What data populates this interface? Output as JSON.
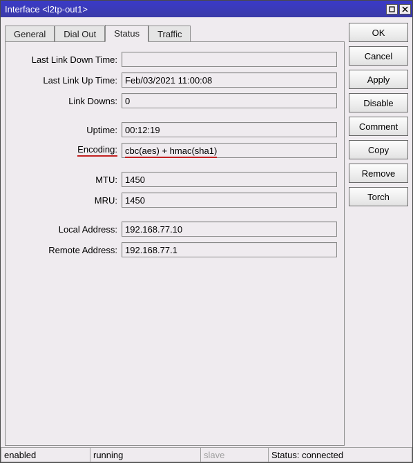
{
  "window": {
    "title": "Interface <l2tp-out1>"
  },
  "tabs": {
    "general": "General",
    "dialout": "Dial Out",
    "status": "Status",
    "traffic": "Traffic"
  },
  "fields": {
    "last_link_down_time": {
      "label": "Last Link Down Time:",
      "value": ""
    },
    "last_link_up_time": {
      "label": "Last Link Up Time:",
      "value": "Feb/03/2021 11:00:08"
    },
    "link_downs": {
      "label": "Link Downs:",
      "value": "0"
    },
    "uptime": {
      "label": "Uptime:",
      "value": "00:12:19"
    },
    "encoding": {
      "label": "Encoding:",
      "value": "cbc(aes) + hmac(sha1)"
    },
    "mtu": {
      "label": "MTU:",
      "value": "1450"
    },
    "mru": {
      "label": "MRU:",
      "value": "1450"
    },
    "local_address": {
      "label": "Local Address:",
      "value": "192.168.77.10"
    },
    "remote_address": {
      "label": "Remote Address:",
      "value": "192.168.77.1"
    }
  },
  "buttons": {
    "ok": "OK",
    "cancel": "Cancel",
    "apply": "Apply",
    "disable": "Disable",
    "comment": "Comment",
    "copy": "Copy",
    "remove": "Remove",
    "torch": "Torch"
  },
  "status": {
    "enabled": "enabled",
    "running": "running",
    "slave": "slave",
    "connected": "Status: connected"
  }
}
